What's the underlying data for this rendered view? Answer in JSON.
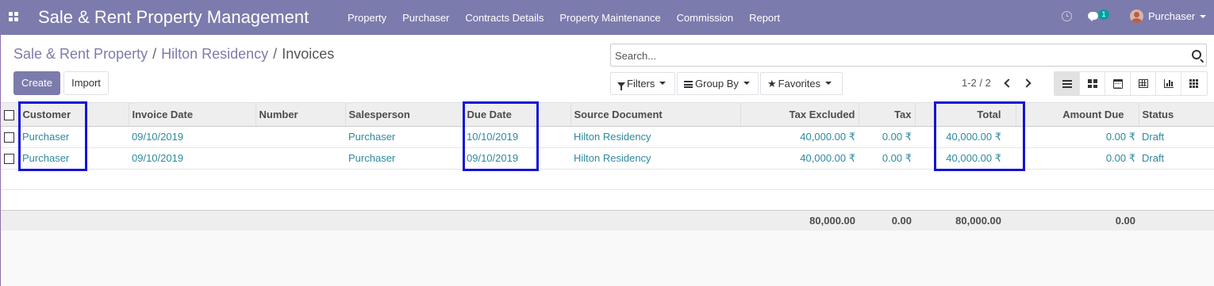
{
  "app": {
    "title": "Sale & Rent Property Management",
    "menu": [
      "Property",
      "Purchaser",
      "Contracts Details",
      "Property Maintenance",
      "Commission",
      "Report"
    ],
    "notification_count": "1",
    "user": "Purchaser"
  },
  "breadcrumb": {
    "items": [
      "Sale & Rent Property",
      "Hilton Residency"
    ],
    "current": "Invoices"
  },
  "actions": {
    "create_label": "Create",
    "import_label": "Import"
  },
  "search": {
    "placeholder": "Search...",
    "filters_label": "Filters",
    "group_by_label": "Group By",
    "favorites_label": "Favorites"
  },
  "pager": {
    "text": "1-2 / 2"
  },
  "views": [
    "list",
    "kanban",
    "calendar",
    "pivot",
    "graph",
    "grid"
  ],
  "table": {
    "columns": [
      "Customer",
      "Invoice Date",
      "Number",
      "Salesperson",
      "Due Date",
      "Source Document",
      "Tax Excluded",
      "Tax",
      "Total",
      "Amount Due",
      "Status"
    ],
    "rows": [
      {
        "customer": "Purchaser",
        "invoice_date": "09/10/2019",
        "number": "",
        "salesperson": "Purchaser",
        "due_date": "10/10/2019",
        "source_document": "Hilton Residency",
        "tax_excluded": "40,000.00 ₹",
        "tax": "0.00 ₹",
        "total": "40,000.00 ₹",
        "amount_due": "0.00 ₹",
        "status": "Draft"
      },
      {
        "customer": "Purchaser",
        "invoice_date": "09/10/2019",
        "number": "",
        "salesperson": "Purchaser",
        "due_date": "09/10/2019",
        "source_document": "Hilton Residency",
        "tax_excluded": "40,000.00 ₹",
        "tax": "0.00 ₹",
        "total": "40,000.00 ₹",
        "amount_due": "0.00 ₹",
        "status": "Draft"
      }
    ],
    "totals": {
      "tax_excluded": "80,000.00",
      "tax": "0.00",
      "total": "80,000.00",
      "amount_due": "0.00"
    }
  },
  "colors": {
    "navbar": "#7c7bad",
    "link": "#2e8a9e",
    "highlight": "#1414d6",
    "badge": "#00a09d"
  }
}
